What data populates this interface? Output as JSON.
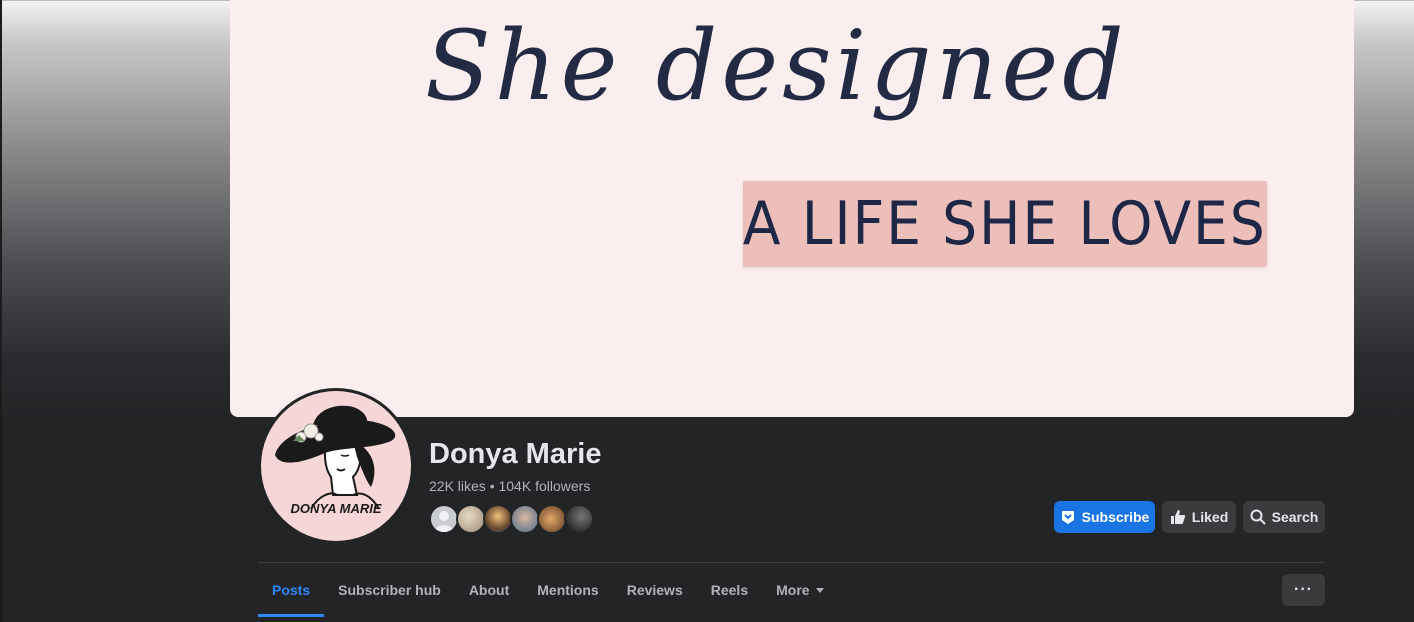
{
  "cover": {
    "script_text": "She designed",
    "band_text": "A LIFE SHE LOVES",
    "background_color": "#fbeeee",
    "band_color": "#ecbfba"
  },
  "profile": {
    "avatar_text": "DONYA MARIE",
    "name": "Donya Marie",
    "stats": "22K likes • 104K followers",
    "friend_avatars": [
      "avatar-1",
      "avatar-2",
      "avatar-3",
      "avatar-4",
      "avatar-5",
      "avatar-6"
    ]
  },
  "actions": {
    "subscribe_label": "Subscribe",
    "liked_label": "Liked",
    "search_label": "Search",
    "more_options_label": "···"
  },
  "tabs": [
    {
      "label": "Posts",
      "active": true
    },
    {
      "label": "Subscriber hub",
      "active": false
    },
    {
      "label": "About",
      "active": false
    },
    {
      "label": "Mentions",
      "active": false
    },
    {
      "label": "Reviews",
      "active": false
    },
    {
      "label": "Reels",
      "active": false
    },
    {
      "label": "More",
      "active": false
    }
  ],
  "colors": {
    "accent": "#2d88ff",
    "primary_button": "#1b74e4",
    "secondary_button": "#3a3b3c",
    "background": "#232426"
  }
}
